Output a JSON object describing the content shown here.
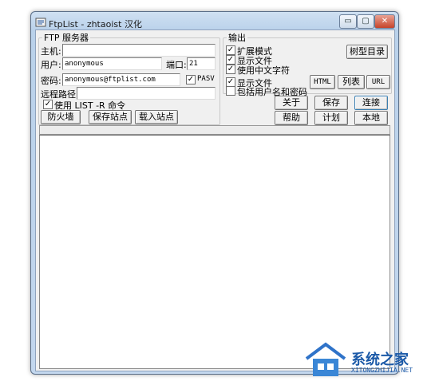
{
  "window": {
    "title": "FtpList - zhtaoist 汉化",
    "controls": {
      "minimize": "▭",
      "maximize": "▢",
      "close": "✕"
    }
  },
  "ftp_server": {
    "group_label": "FTP 服务器",
    "host_label": "主机:",
    "host_value": "",
    "user_label": "用户:",
    "user_value": "anonymous",
    "port_label": "端口:",
    "port_value": "21",
    "password_label": "密码:",
    "password_value": "anonymous@ftplist.com",
    "pasv_label": "PASV",
    "pasv_checked": true,
    "remote_path_label": "远程路径:",
    "remote_path_value": "",
    "use_list_r_label": "使用 LIST -R 命令",
    "use_list_r_checked": true,
    "firewall_button": "防火墙",
    "save_site_button": "保存站点",
    "load_site_button": "载入站点"
  },
  "output": {
    "group_label": "输出",
    "extended_mode_label": "扩展模式",
    "extended_mode_checked": true,
    "show_files_label": "显示文件",
    "show_files_checked": true,
    "use_chinese_label": "使用中文字符",
    "use_chinese_checked": true,
    "show_files2_label": "显示文件",
    "show_files2_checked": true,
    "include_credentials_label": "包括用户名和密码",
    "include_credentials_checked": false,
    "tree_dir_button": "树型目录",
    "html_button": "HTML",
    "list_button": "列表",
    "url_button": "URL"
  },
  "actions": {
    "about_button": "关于",
    "save_button": "保存",
    "connect_button": "连接",
    "help_button": "帮助",
    "schedule_button": "计划",
    "local_button": "本地"
  },
  "watermark": {
    "title": "系统之家",
    "subtitle": "XITONGZHIJIA.NET"
  },
  "colors": {
    "window_frame": "#b9d1ea",
    "client_bg": "#f0f0f0",
    "close_button": "#c7432a",
    "watermark": "#1c5aa8"
  }
}
